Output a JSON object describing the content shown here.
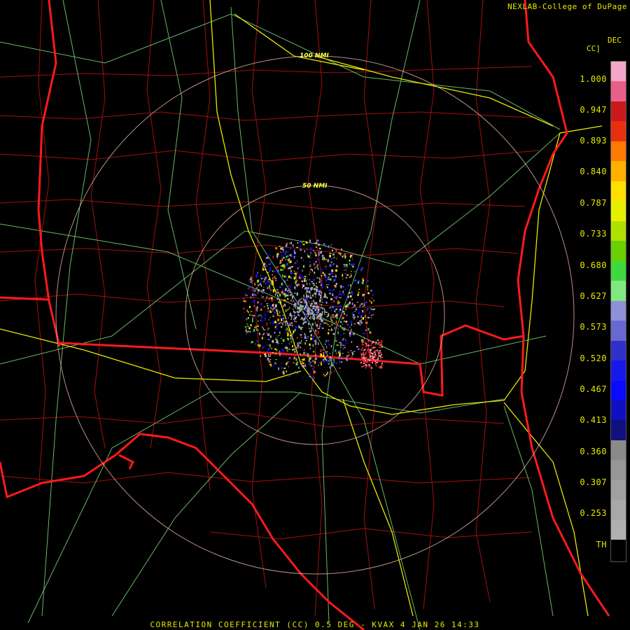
{
  "credit": "NEXLAB-College of DuPage",
  "legend": {
    "title_line1": "DEC",
    "title_line2": "CC]",
    "ticks": [
      "1.000",
      "0.947",
      "0.893",
      "0.840",
      "0.787",
      "0.733",
      "0.680",
      "0.627",
      "0.573",
      "0.520",
      "0.467",
      "0.413",
      "0.360",
      "0.307",
      "0.253",
      "TH"
    ],
    "colors": [
      "#f4a6c8",
      "#e8608a",
      "#c81a1a",
      "#e83010",
      "#ff7a00",
      "#ffb000",
      "#ffe000",
      "#e8f000",
      "#b0e000",
      "#6ad000",
      "#40d840",
      "#80e880",
      "#9090d8",
      "#6868d0",
      "#3030c8",
      "#1818e8",
      "#0a0aff",
      "#1010c0",
      "#101080",
      "#8a8a8a",
      "#969696",
      "#a0a0a0",
      "#a8a8a8",
      "#b0b0b0"
    ]
  },
  "rings": {
    "label_50": "50 NMI",
    "label_100": "100 NMI"
  },
  "footer": "CORRELATION COEFFICIENT (CC) 0.5 DEG - KVAX 4 JAN 26 14:33"
}
